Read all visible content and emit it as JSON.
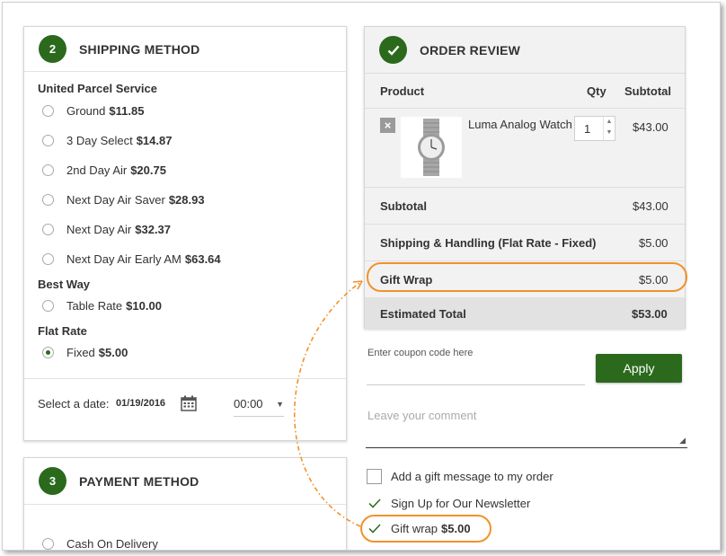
{
  "shipping": {
    "step": "2",
    "title": "SHIPPING METHOD",
    "groups": [
      {
        "title": "United Parcel Service",
        "options": [
          {
            "label": "Ground",
            "price": "$11.85",
            "selected": false
          },
          {
            "label": "3 Day Select",
            "price": "$14.87",
            "selected": false
          },
          {
            "label": "2nd Day Air",
            "price": "$20.75",
            "selected": false
          },
          {
            "label": "Next Day Air Saver",
            "price": "$28.93",
            "selected": false
          },
          {
            "label": "Next Day Air",
            "price": "$32.37",
            "selected": false
          },
          {
            "label": "Next Day Air Early AM",
            "price": "$63.64",
            "selected": false
          }
        ]
      },
      {
        "title": "Best Way",
        "options": [
          {
            "label": "Table Rate",
            "price": "$10.00",
            "selected": false
          }
        ]
      },
      {
        "title": "Flat Rate",
        "options": [
          {
            "label": "Fixed",
            "price": "$5.00",
            "selected": true
          }
        ]
      }
    ],
    "date_label": "Select a date:",
    "date_value": "01/19/2016",
    "time_value": "00:00"
  },
  "payment": {
    "step": "3",
    "title": "PAYMENT METHOD",
    "options": [
      {
        "label": "Cash On Delivery",
        "selected": false
      }
    ]
  },
  "review": {
    "title": "ORDER REVIEW",
    "columns": {
      "product": "Product",
      "qty": "Qty",
      "subtotal": "Subtotal"
    },
    "item": {
      "name": "Luma Analog Watch",
      "qty": "1",
      "subtotal": "$43.00",
      "remove": "×"
    },
    "totals": [
      {
        "label": "Subtotal",
        "value": "$43.00"
      },
      {
        "label": "Shipping & Handling (Flat Rate - Fixed)",
        "value": "$5.00"
      },
      {
        "label": "Gift Wrap",
        "value": "$5.00"
      }
    ],
    "grand_total": {
      "label": "Estimated Total",
      "value": "$53.00"
    }
  },
  "coupon": {
    "placeholder": "Enter coupon code here",
    "apply_label": "Apply"
  },
  "comment": {
    "placeholder": "Leave your comment"
  },
  "options": {
    "gift_message": {
      "label": "Add a gift message to my order",
      "checked": false
    },
    "newsletter": {
      "label": "Sign Up for Our Newsletter",
      "checked": true
    },
    "gift_wrap": {
      "label": "Gift wrap",
      "price": "$5.00",
      "checked": true
    }
  },
  "colors": {
    "accent": "#2b6a1d",
    "highlight": "#f1922b"
  }
}
